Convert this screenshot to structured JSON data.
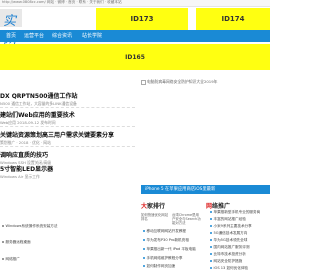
{
  "topbar": {
    "url_text": "http://www.0808cc.com/  网站 · 微博 · 首页 · 联系 · 关于我们 · 收藏本站"
  },
  "logo": {
    "text": "实网"
  },
  "ads": {
    "top1": "ID173",
    "top2": "ID174",
    "banner": "ID165"
  },
  "nav": {
    "items": [
      "首页",
      "运营平台",
      "综合资讯",
      "站长学院"
    ]
  },
  "ad_image_alt": "电脑防病毒网络安全防护知识大全2019年",
  "articles": [
    {
      "title": "DX QRPTN500通信工作站",
      "sub": "N500 通信工作站，大容量的多LINK通信设备"
    },
    {
      "title": "建站们Web应用的重要技术",
      "sub": "Web应用    2018-09-12 发布时间"
    },
    {
      "title": "关键站资源策划高三用户需求关键要素分享",
      "sub": "策划推广 · 2018 · 优化 · 网站"
    },
    {
      "title": "调响应直质的技巧",
      "sub": "Windows SSH 设置关闭/高级"
    },
    {
      "title": "5寸智能LED显示器",
      "sub": "Windows Air 显示工作"
    }
  ],
  "left_list": [
    "Windows系统操作系统安装方法",
    "服务器远程桌面",
    "网络推广"
  ],
  "bluebar": {
    "text": "iPhone 5 在苹果应用商店iOS里最新"
  },
  "panel_mid": {
    "title_prefix": "大",
    "title_suffix": "家排行",
    "thumbs": [
      "如何快速优化网站排名",
      "台湾Chrome是用户安全与Search功能对方法"
    ],
    "items": [
      "移动互联网网站开发教程",
      "华为发布P30 Pro新机亮相",
      "苹果推出新一代 iPad 平板电脑",
      "手机网络维护教程分享",
      "如何制作网页加速"
    ]
  },
  "panel_right": {
    "title_prefix": "网",
    "title_suffix": "络推广",
    "items": [
      "苹果推新型手机专业的服务商",
      "丰富的网站推广经验",
      "小米9系列主要技术分享",
      "5G通信技术发展方向",
      "华为5G技术领先全球",
      "国内网站推广服务评测",
      "比特币技术投资分析",
      "网站安全防护措施",
      "iOS 13 如何优化体验"
    ]
  }
}
